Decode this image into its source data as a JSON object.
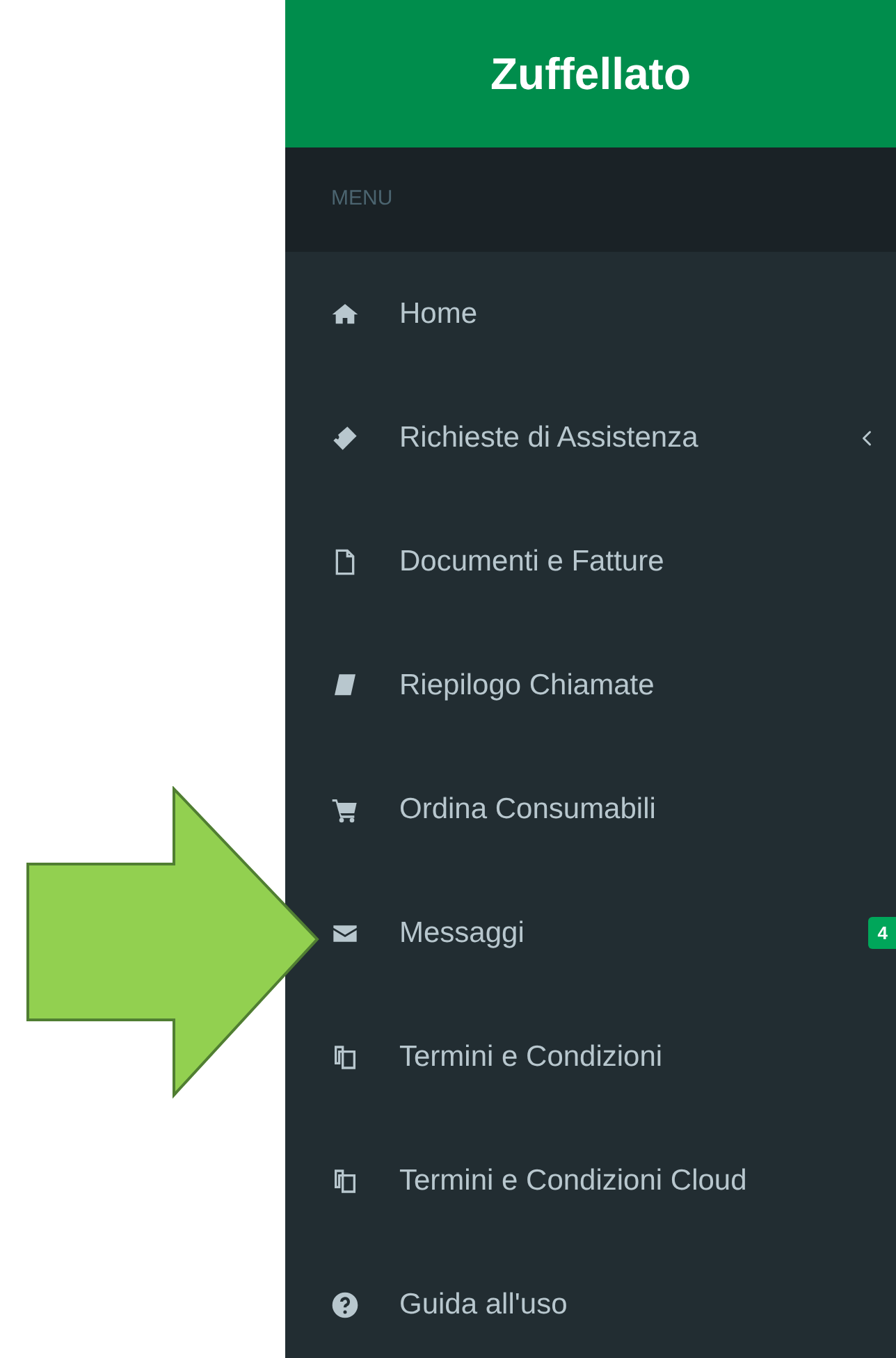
{
  "header": {
    "title": "Zuffellato"
  },
  "menu": {
    "heading": "MENU",
    "items": [
      {
        "label": "Home",
        "submenu": false
      },
      {
        "label": "Richieste di Assistenza",
        "submenu": true
      },
      {
        "label": "Documenti e Fatture",
        "submenu": false
      },
      {
        "label": "Riepilogo Chiamate",
        "submenu": false
      },
      {
        "label": "Ordina Consumabili",
        "submenu": false
      },
      {
        "label": "Messaggi",
        "submenu": false,
        "badge": "4"
      },
      {
        "label": "Termini e Condizioni",
        "submenu": false
      },
      {
        "label": "Termini e Condizioni Cloud",
        "submenu": false
      },
      {
        "label": "Guida all'uso",
        "submenu": false
      }
    ]
  }
}
